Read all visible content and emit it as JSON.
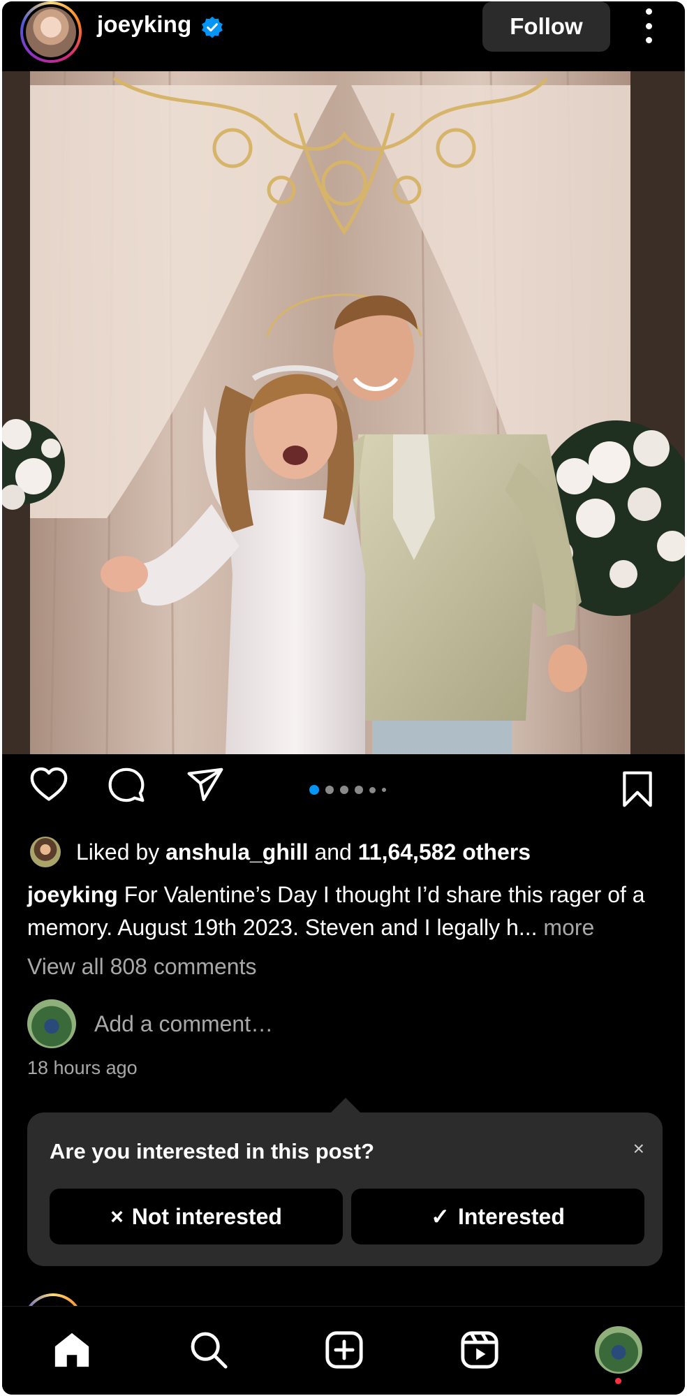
{
  "post": {
    "username": "joeyking",
    "follow_label": "Follow",
    "liked_by_prefix": "Liked by",
    "liked_by_user": "anshula_ghill",
    "liked_by_and": "and",
    "likes_others": "11,64,582 others",
    "caption_user": "joeyking",
    "caption_text": "For Valentine’s Day I thought I’d share this rager of a  memory. August 19th 2023. Steven and I legally h...",
    "caption_more": "more",
    "view_comments": "View all 808 comments",
    "add_comment_placeholder": "Add a comment…",
    "timestamp": "18 hours ago",
    "carousel": {
      "total": 6,
      "current": 1
    }
  },
  "interest_card": {
    "question": "Are you interested in this post?",
    "close_label": "×",
    "not_interested_label": "Not interested",
    "not_interested_icon": "×",
    "interested_label": "Interested",
    "interested_icon": "✓"
  },
  "icons": {
    "header": [
      "verified-badge-icon",
      "more-options-icon"
    ],
    "actions": [
      "heart-icon",
      "comment-icon",
      "share-icon",
      "bookmark-icon"
    ],
    "nav": [
      "home-icon",
      "search-icon",
      "create-icon",
      "reels-icon",
      "profile-avatar"
    ]
  },
  "colors": {
    "background": "#000000",
    "verified": "#0095f6",
    "carousel_active": "#0095f6",
    "card_background": "#2c2c2c",
    "notification_dot": "#ff3040"
  }
}
